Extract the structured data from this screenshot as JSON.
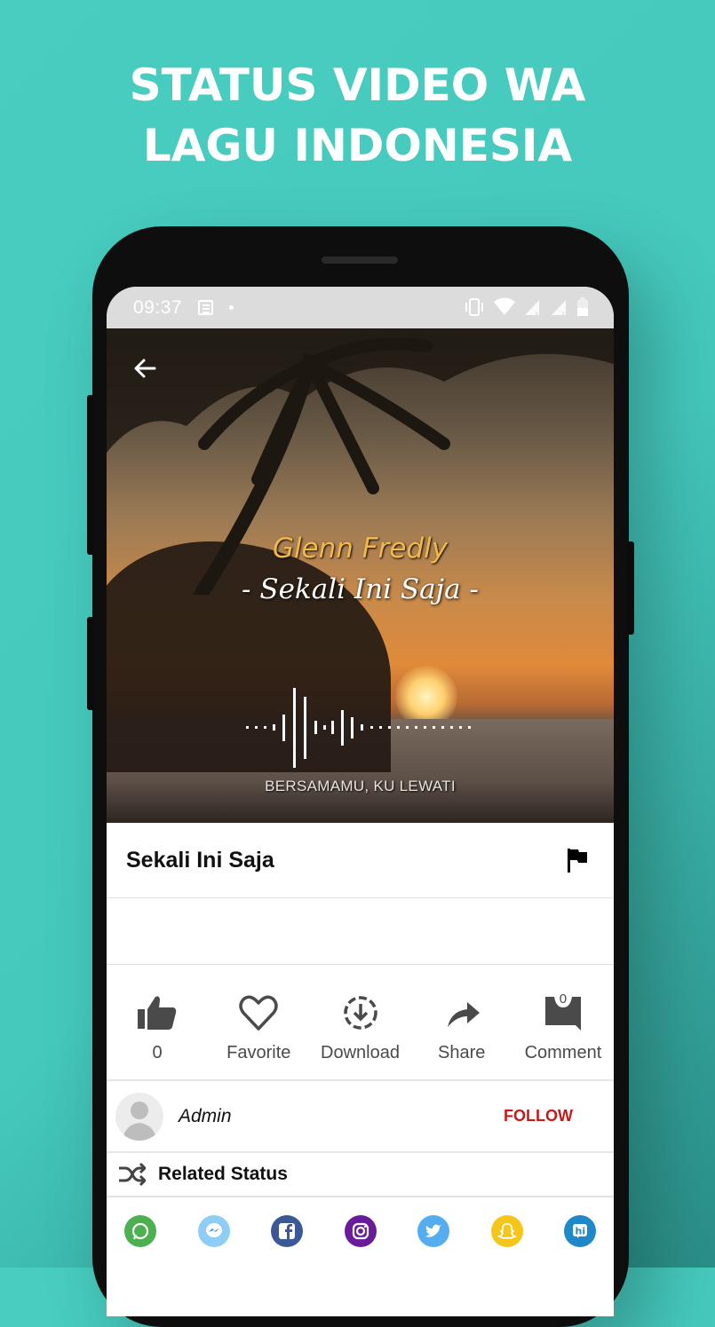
{
  "promo": {
    "headline_line1": "STATUS VIDEO WA",
    "headline_line2": "LAGU INDONESIA",
    "background_color": "#48cdc0"
  },
  "statusbar": {
    "time": "09:37",
    "left_icons": [
      "news-icon",
      "dot-icon"
    ],
    "right_icons": [
      "vibrate-icon",
      "wifi-icon",
      "signal-no-service-icon",
      "signal-no-service-icon",
      "battery-icon"
    ]
  },
  "video": {
    "artist": "Glenn Fredly",
    "song_overlay": "- Sekali Ini Saja -",
    "lyric": "BERSAMAMU, KU LEWATI",
    "back_icon": "arrow-left-icon"
  },
  "detail": {
    "title": "Sekali Ini Saja",
    "report_icon": "flag-icon"
  },
  "actions": [
    {
      "name": "like",
      "icon": "thumbs-up-icon",
      "label": "0"
    },
    {
      "name": "favorite",
      "icon": "heart-icon",
      "label": "Favorite"
    },
    {
      "name": "download",
      "icon": "download-icon",
      "label": "Download"
    },
    {
      "name": "share",
      "icon": "share-icon",
      "label": "Share"
    },
    {
      "name": "comment",
      "icon": "comment-icon",
      "label": "Comment",
      "badge": "0"
    }
  ],
  "author": {
    "name": "Admin",
    "follow_label": "FOLLOW",
    "follow_color": "#c41a1a"
  },
  "related": {
    "label": "Related Status",
    "icon": "shuffle-icon"
  },
  "share_apps": [
    {
      "name": "whatsapp",
      "color": "#4caf50"
    },
    {
      "name": "messenger",
      "color": "#8ecdf5"
    },
    {
      "name": "facebook",
      "color": "#3b5998"
    },
    {
      "name": "instagram",
      "color": "#6a1b9a"
    },
    {
      "name": "twitter",
      "color": "#55acee"
    },
    {
      "name": "snapchat",
      "color": "#f5c518"
    },
    {
      "name": "hike",
      "color": "#1e88c8"
    }
  ]
}
